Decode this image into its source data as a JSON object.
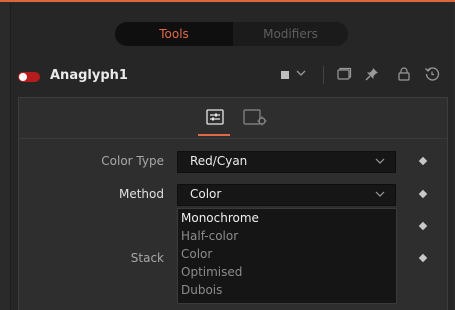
{
  "tabs": [
    {
      "label": "Tools",
      "active": true
    },
    {
      "label": "Modifiers",
      "active": false
    }
  ],
  "tool": {
    "name": "Anaglyph1",
    "enabled": true
  },
  "header_icons": [
    "color-swatch-icon",
    "chevron-down-icon",
    "window-icon",
    "pin-icon",
    "lock-icon",
    "reset-icon"
  ],
  "inspector": {
    "icon_tabs": [
      "controls-icon",
      "settings-icon"
    ],
    "fields": [
      {
        "label": "Color Type",
        "value": "Red/Cyan"
      },
      {
        "label": "Method",
        "value": "Color"
      },
      {
        "label": "Stack",
        "value": ""
      }
    ],
    "dropdown": {
      "options": [
        "Monochrome",
        "Half-color",
        "Color",
        "Optimised",
        "Dubois"
      ],
      "highlighted": "Monochrome"
    }
  },
  "colors": {
    "accent": "#e06a45",
    "toggle_on": "#b51c1c",
    "panel": "#262626"
  }
}
